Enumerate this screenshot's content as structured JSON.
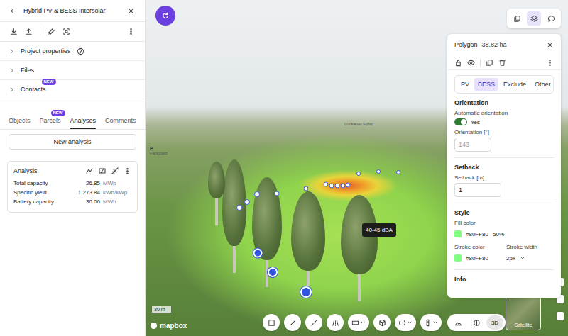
{
  "sidebar": {
    "title": "Hybrid PV & BESS Intersolar",
    "sections": [
      {
        "label": "Project properties",
        "help": true,
        "expanded": false
      },
      {
        "label": "Files",
        "help": false,
        "expanded": false
      },
      {
        "label": "Contacts",
        "help": false,
        "expanded": false,
        "badge": "NEW"
      }
    ],
    "tabs": [
      {
        "label": "Objects",
        "selected": false
      },
      {
        "label": "Parcels",
        "selected": false,
        "badge": "NEW"
      },
      {
        "label": "Analyses",
        "selected": true
      },
      {
        "label": "Comments",
        "selected": false
      }
    ],
    "new_analysis": "New analysis",
    "analysis": {
      "title": "Analysis",
      "rows": [
        {
          "label": "Total capacity",
          "value": "26.85",
          "unit": "MWp"
        },
        {
          "label": "Specific yield",
          "value": "1,273.84",
          "unit": "kWh/kWp"
        },
        {
          "label": "Battery capacity",
          "value": "30.06",
          "unit": "MWh"
        }
      ]
    }
  },
  "map": {
    "labels": [
      "Luckauer Forst",
      "Parkplatz"
    ],
    "parking_marker": "P",
    "tooltip": "40-45 dBA",
    "scale": "30 m",
    "attribution": "mapbox",
    "basemap": "Satellite",
    "layer_buttons": [
      {
        "selected": false
      },
      {
        "selected": true
      },
      {
        "selected": false
      }
    ],
    "view_modes": [
      {
        "selected": false
      },
      {
        "selected": false
      },
      {
        "label": "3D",
        "selected": true
      }
    ]
  },
  "panel": {
    "title": "Polygon",
    "area": "38.82 ha",
    "types": [
      {
        "label": "PV",
        "selected": false
      },
      {
        "label": "BESS",
        "selected": true
      },
      {
        "label": "Exclude",
        "selected": false
      },
      {
        "label": "Other",
        "selected": false
      }
    ],
    "orientation": {
      "heading": "Orientation",
      "auto_label": "Automatic orientation",
      "auto": {
        "on": true,
        "label": "Yes"
      },
      "field_label": "Orientation [°]",
      "value": "143",
      "disabled": true
    },
    "setback": {
      "heading": "Setback",
      "field_label": "Setback [m]",
      "value": "1"
    },
    "style": {
      "heading": "Style",
      "fill": {
        "label": "Fill color",
        "color": "#80FF80",
        "hex": "#80FF80",
        "opacity": "50%"
      },
      "stroke": {
        "label": "Stroke color",
        "color": "#80FF80",
        "hex": "#80FF80"
      },
      "stroke_width": {
        "label": "Stroke width",
        "value": "2px"
      }
    },
    "info": {
      "heading": "Info"
    }
  }
}
